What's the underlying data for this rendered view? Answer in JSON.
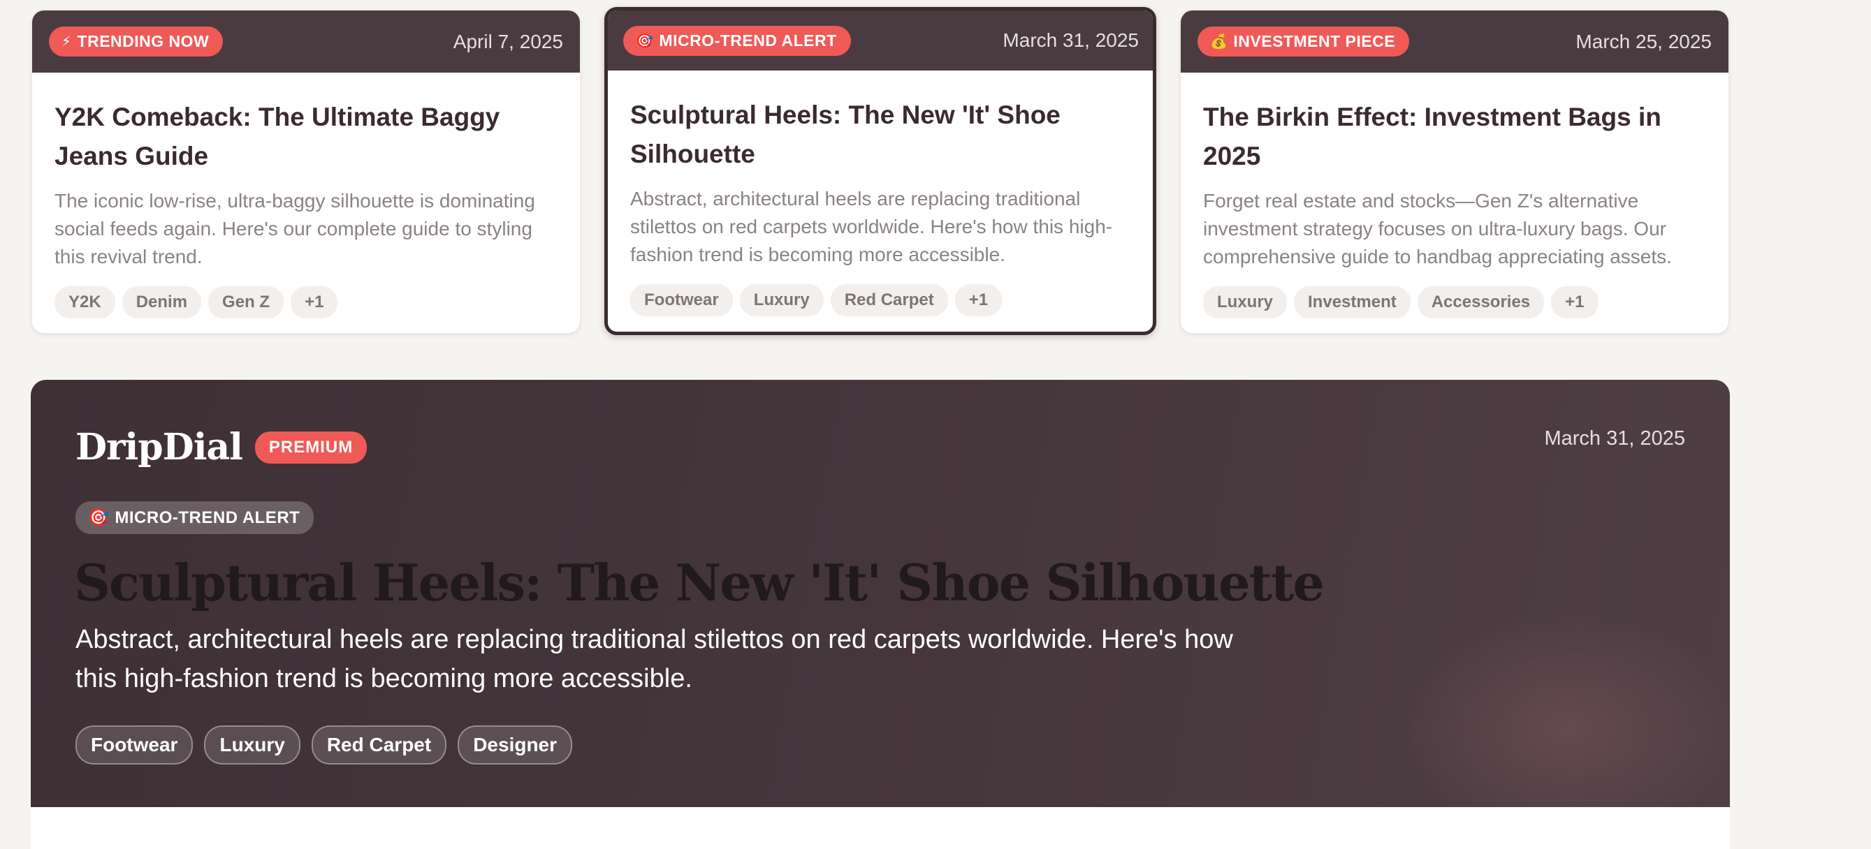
{
  "cards": [
    {
      "badge": {
        "icon": "⚡",
        "label": "TRENDING NOW"
      },
      "date": "April 7, 2025",
      "title": "Y2K Comeback: The Ultimate Baggy Jeans Guide",
      "description": "The iconic low-rise, ultra-baggy silhouette is dominating social feeds again. Here's our complete guide to styling this revival trend.",
      "tags": [
        "Y2K",
        "Denim",
        "Gen Z",
        "+1"
      ]
    },
    {
      "badge": {
        "icon": "🎯",
        "label": "MICRO-TREND ALERT"
      },
      "date": "March 31, 2025",
      "title": "Sculptural Heels: The New 'It' Shoe Silhouette",
      "description": "Abstract, architectural heels are replacing traditional stilettos on red carpets worldwide. Here's how this high-fashion trend is becoming more accessible.",
      "tags": [
        "Footwear",
        "Luxury",
        "Red Carpet",
        "+1"
      ]
    },
    {
      "badge": {
        "icon": "💰",
        "label": "INVESTMENT PIECE"
      },
      "date": "March 25, 2025",
      "title": "The Birkin Effect: Investment Bags in 2025",
      "description": "Forget real estate and stocks—Gen Z's alternative investment strategy focuses on ultra-luxury bags. Our comprehensive guide to handbag appreciating assets.",
      "tags": [
        "Luxury",
        "Investment",
        "Accessories",
        "+1"
      ]
    }
  ],
  "hero": {
    "logo": "DripDial",
    "premium_label": "PREMIUM",
    "date": "March 31, 2025",
    "badge": {
      "icon": "🎯",
      "label": "MICRO-TREND ALERT"
    },
    "title": "Sculptural Heels: The New 'It' Shoe Silhouette",
    "description": "Abstract, architectural heels are replacing traditional stilettos on red carpets worldwide. Here's how this high-fashion trend is becoming more accessible.",
    "tags": [
      "Footwear",
      "Luxury",
      "Red Carpet",
      "Designer"
    ]
  },
  "colors": {
    "accent": "#ef5a57",
    "header_dark": "#4a3b41",
    "background": "#f6f4f1"
  }
}
